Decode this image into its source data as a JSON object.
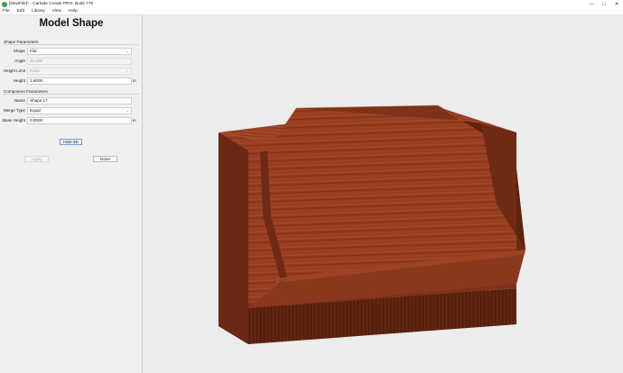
{
  "window": {
    "title": "[NewFile]* - Carbide Create PRO, Build 778",
    "controls": {
      "minimize": "—",
      "maximize": "□",
      "close": "✕"
    }
  },
  "menu": [
    "File",
    "Edit",
    "Library",
    "View",
    "Help"
  ],
  "panel": {
    "title": "Model Shape",
    "shape_params": {
      "label": "Shape Parameters",
      "shape": {
        "label": "Shape",
        "value": "Flat"
      },
      "angle": {
        "label": "Angle",
        "value": "45.000"
      },
      "height_limit": {
        "label": "Height Limit",
        "value": "None"
      },
      "height": {
        "label": "Height",
        "value": "1.5000",
        "unit": "in"
      }
    },
    "component_params": {
      "label": "Component Parameters",
      "name": {
        "label": "Name",
        "value": "Shape 17"
      },
      "merge_type": {
        "label": "Merge Type",
        "value": "Equal"
      },
      "base_height": {
        "label": "Base Height",
        "value": "0.0000",
        "unit": "in"
      }
    },
    "buttons": {
      "hide_3d": "Hide 3D",
      "apply": "Apply",
      "done": "Done"
    }
  },
  "colors": {
    "wood_light": "#a9482a",
    "wood_mid": "#8f3a1f",
    "wood_dark": "#6b2914",
    "wood_shadow": "#4f1d0d"
  }
}
